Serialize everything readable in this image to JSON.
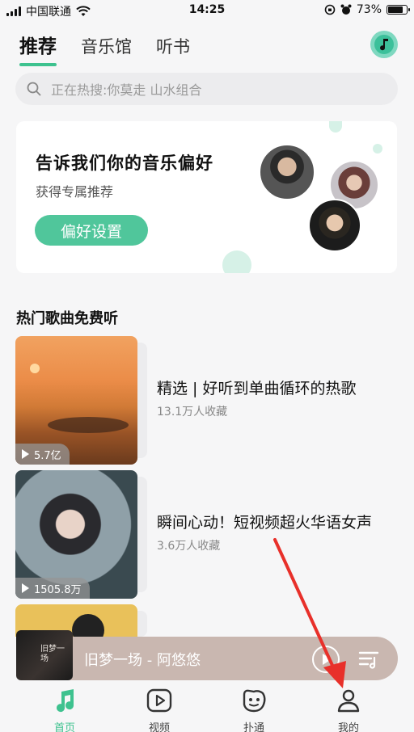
{
  "status_bar": {
    "carrier": "中国联通",
    "time": "14:25",
    "battery": "73%",
    "battery_level": 0.73
  },
  "tabs": [
    {
      "label": "推荐",
      "active": true
    },
    {
      "label": "音乐馆",
      "active": false
    },
    {
      "label": "听书",
      "active": false
    }
  ],
  "search": {
    "text": "正在热搜:你莫走 山水组合"
  },
  "preference_card": {
    "title": "告诉我们你的音乐偏好",
    "subtitle": "获得专属推荐",
    "button_label": "偏好设置"
  },
  "section": {
    "title": "热门歌曲免费听"
  },
  "songs": [
    {
      "title": "精选 | 好听到单曲循环的热歌",
      "favorites": "13.1万人收藏",
      "plays": "5.7亿"
    },
    {
      "title": "瞬间心动！短视频超火华语女声",
      "favorites": "3.6万人收藏",
      "plays": "1505.8万"
    }
  ],
  "player": {
    "track": "旧梦一场 - 阿悠悠",
    "cover_text": "旧梦一场"
  },
  "bottom_nav": [
    {
      "label": "首页",
      "icon": "music-note-icon",
      "active": true
    },
    {
      "label": "视频",
      "icon": "video-play-icon",
      "active": false
    },
    {
      "label": "扑通",
      "icon": "emoji-face-icon",
      "active": false
    },
    {
      "label": "我的",
      "icon": "person-icon",
      "active": false
    }
  ],
  "colors": {
    "accent": "#3ec28f",
    "player_bg": "#c9b7b0"
  }
}
